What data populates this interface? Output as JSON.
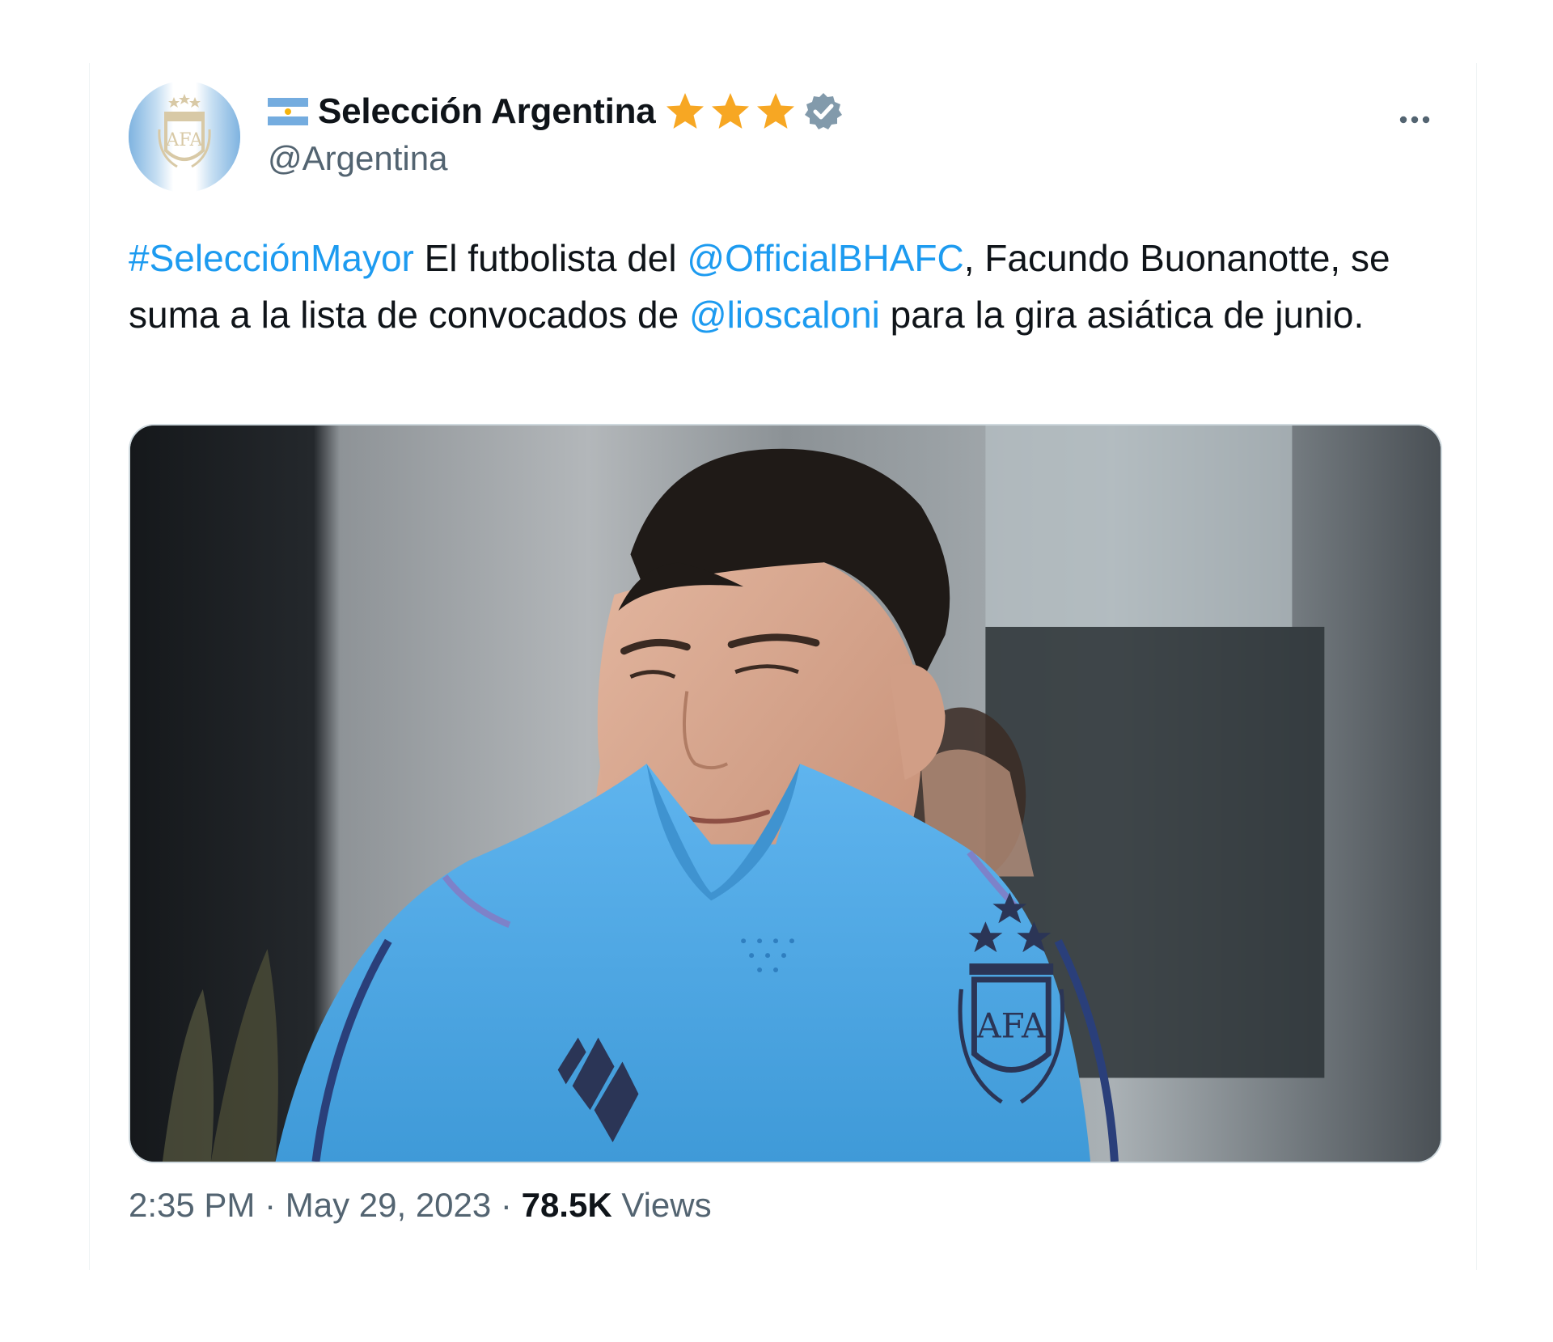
{
  "tweet": {
    "display_name": "Selección Argentina",
    "handle": "@Argentina",
    "flag_icon": "argentina-flag-icon",
    "badge_icons": [
      "star-icon",
      "star-icon",
      "star-icon",
      "verified-badge-icon"
    ],
    "star_color": "#f7a723",
    "verified_color": "#829aab",
    "text": {
      "hashtag": "#SelecciónMayor",
      "part1": " El futbolista del ",
      "mention1": "@OfficialBHAFC",
      "part2": ", Facundo Buonanotte, se suma a la lista de convocados de ",
      "mention2": "@lioscaloni",
      "part3": " para la gira asiática de junio."
    },
    "link_color": "#1d9bf0",
    "time": "2:35 PM",
    "separator": " · ",
    "date": "May 29, 2023",
    "views_count": "78.5K",
    "views_label": " Views"
  },
  "avatar": {
    "crest_text": "AFA"
  },
  "media": {
    "crest_text": "AFA"
  }
}
